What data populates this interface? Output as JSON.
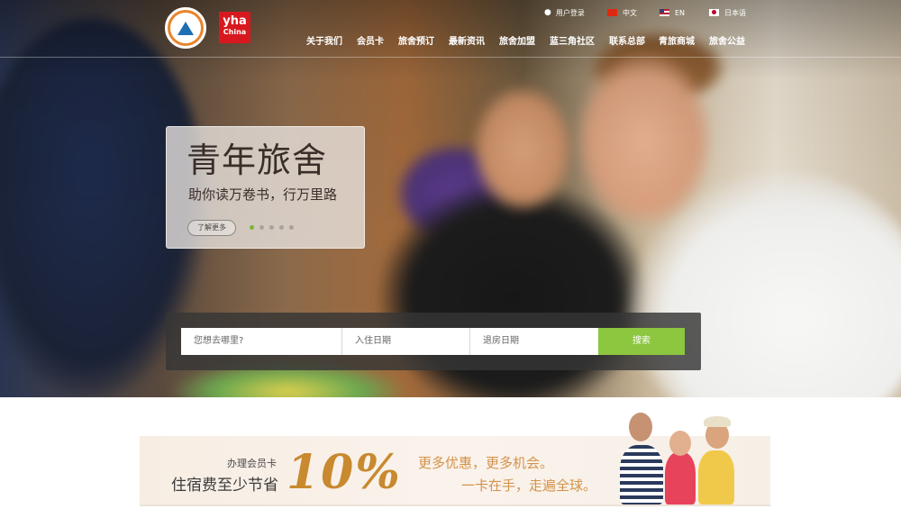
{
  "brand": {
    "hi_logo_name": "hostelling-international-logo",
    "yha_logo_line1": "yha",
    "yha_logo_line2": "China",
    "colors": {
      "accent_green": "#8dc63f",
      "yha_red": "#d7191f",
      "promo_gold": "#c8892f"
    }
  },
  "utility_nav": {
    "login": "用户登录",
    "lang_cn": "中文",
    "lang_en": "EN",
    "lang_jp": "日本语"
  },
  "main_nav": [
    "关于我们",
    "会员卡",
    "旅舍预订",
    "最新资讯",
    "旅舍加盟",
    "蓝三角社区",
    "联系总部",
    "青旅商城",
    "旅舍公益"
  ],
  "hero": {
    "title": "青年旅舍",
    "subtitle": "助你读万卷书，行万里路",
    "learn_more": "了解更多",
    "slide_count": 5,
    "active_slide": 1
  },
  "search": {
    "destination_placeholder": "您想去哪里?",
    "checkin_placeholder": "入住日期",
    "checkout_placeholder": "退房日期",
    "button": "搜索"
  },
  "promo": {
    "line1": "办理会员卡",
    "line2": "住宿费至少节省",
    "percent": "10%",
    "right1": "更多优惠，更多机会。",
    "right2": "一卡在手，走遍全球。"
  }
}
